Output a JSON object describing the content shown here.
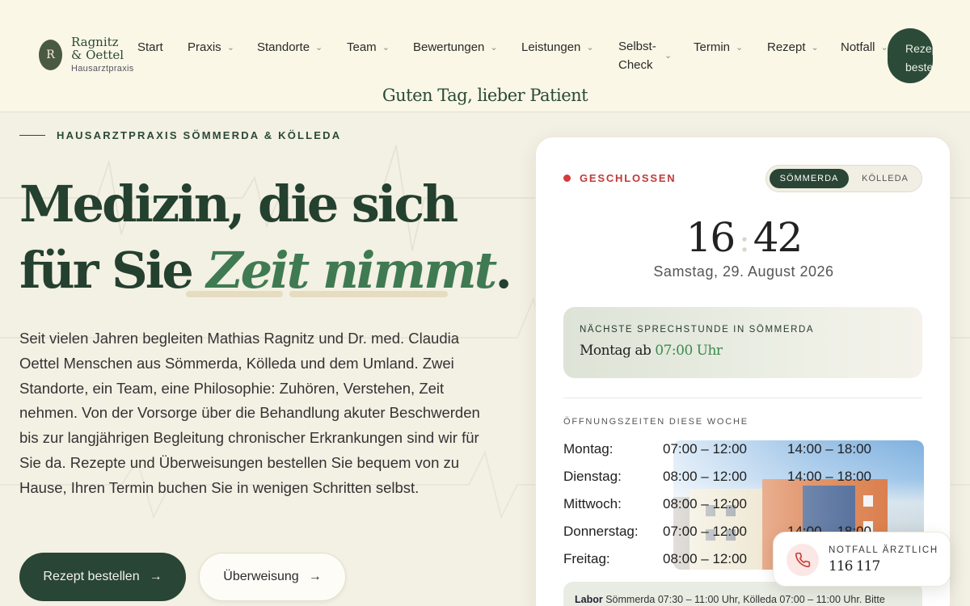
{
  "header": {
    "logo_initial": "R",
    "logo_name": "Ragnitz & Oettel",
    "logo_subtitle": "Hausarztpraxis",
    "nav": [
      {
        "label": "Start",
        "has_dropdown": false
      },
      {
        "label": "Praxis",
        "has_dropdown": true
      },
      {
        "label": "Standorte",
        "has_dropdown": true
      },
      {
        "label": "Team",
        "has_dropdown": true
      },
      {
        "label": "Bewertungen",
        "has_dropdown": true
      },
      {
        "label": "Leistungen",
        "has_dropdown": true
      },
      {
        "label": "Selbst-Check",
        "has_dropdown": true
      },
      {
        "label": "Termin",
        "has_dropdown": true
      },
      {
        "label": "Rezept",
        "has_dropdown": true
      },
      {
        "label": "Notfall",
        "has_dropdown": true
      }
    ],
    "cta_label": "Rezept bestellen",
    "greeting": "Guten Tag, lieber Patient"
  },
  "hero": {
    "eyebrow": "HAUSARZTPRAXIS SÖMMERDA & KÖLLEDA",
    "headline_line1": "Medizin, die sich",
    "headline_line2_plain": "für Sie ",
    "headline_line2_italic": "Zeit nimmt",
    "headline_line2_end": ".",
    "intro": "Seit vielen Jahren begleiten Mathias Ragnitz und Dr. med. Claudia Oettel Menschen aus Sömmerda, Kölleda und dem Umland. Zwei Standorte, ein Team, eine Philosophie: Zuhören, Verstehen, Zeit nehmen. Von der Vorsorge über die Behandlung akuter Beschwerden bis zur langjährigen Begleitung chronischer Erkrankungen sind wir für Sie da. Rezepte und Überweisungen bestellen Sie bequem von zu Hause, Ihren Termin buchen Sie in wenigen Schritten selbst.",
    "primary_button": "Rezept bestellen",
    "secondary_button": "Überweisung",
    "arrow": "→"
  },
  "card": {
    "status": "GESCHLOSSEN",
    "locations": [
      "SÖMMERDA",
      "KÖLLEDA"
    ],
    "active_location": "SÖMMERDA",
    "time_hours": "16",
    "time_minutes": "42",
    "date": "Samstag, 29. August 2026",
    "next_label": "NÄCHSTE SPRECHSTUNDE IN SÖMMERDA",
    "next_day": "Montag ab ",
    "next_time": "07:00 Uhr",
    "hours_label": "ÖFFNUNGSZEITEN DIESE WOCHE",
    "hours": [
      {
        "day": "Montag:",
        "am": "07:00 – 12:00",
        "pm": "14:00 – 18:00"
      },
      {
        "day": "Dienstag:",
        "am": "08:00 – 12:00",
        "pm": "14:00 – 18:00"
      },
      {
        "day": "Mittwoch:",
        "am": "08:00 – 12:00",
        "pm": ""
      },
      {
        "day": "Donnerstag:",
        "am": "07:00 – 12:00",
        "pm": "14:00 – 18:00"
      },
      {
        "day": "Freitag:",
        "am": "08:00 – 12:00",
        "pm": ""
      }
    ],
    "labor_bold": "Labor",
    "labor_text": " Sömmerda 07:30 – 11:00 Uhr, Kölleda 07:00 – 11:00 Uhr. Bitte"
  },
  "emergency": {
    "label": "NOTFALL ÄRZTLICH",
    "number": "116 117"
  },
  "colors": {
    "primary": "#284535",
    "accent_green": "#3f7a52",
    "closed_red": "#d43b3b",
    "background": "#f3f0e4"
  }
}
